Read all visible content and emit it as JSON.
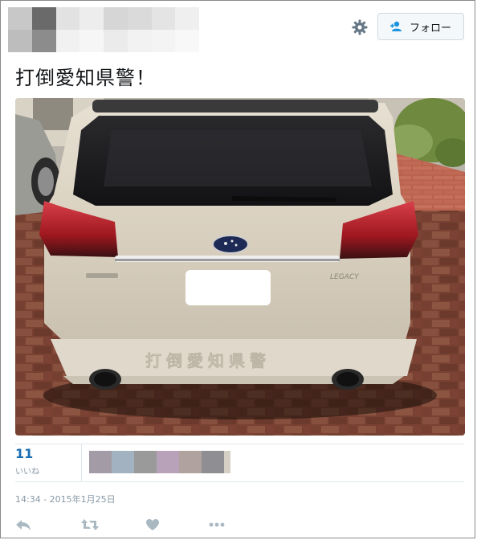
{
  "header": {
    "follow_label": "フォロー",
    "blur_colors": [
      "#c8c8c8",
      "#6a6a6a",
      "#e2e2e2",
      "#ededed",
      "#d6d6d6",
      "#dadada",
      "#e4e4e4",
      "#efefef",
      "#bdbdbd",
      "#8c8c8c",
      "#f1f1f1",
      "#f6f6f6",
      "#ebebeb",
      "#f2f2f2",
      "#f4f4f4",
      "#f8f8f8"
    ]
  },
  "tweet": {
    "text": "打倒愛知県警！",
    "photo": {
      "bumper_text": "打倒愛知県警",
      "badge": "LEGACY"
    }
  },
  "stats": {
    "likes_count": "11",
    "likes_label": "いいね",
    "liker_colors": [
      "#a39ba6",
      "#a3b2c1",
      "#9a9a9a",
      "#b8a2b9",
      "#b0a39f",
      "#8f8e92",
      "#d6cfc6"
    ]
  },
  "timestamp": "14:34 - 2015年1月25日",
  "actions": {
    "icons": [
      "reply-icon",
      "retweet-icon",
      "like-icon",
      "more-icon"
    ]
  },
  "colors": {
    "accent": "#1b6fb3",
    "muted": "#8899a6",
    "border": "#e1e8ed"
  }
}
